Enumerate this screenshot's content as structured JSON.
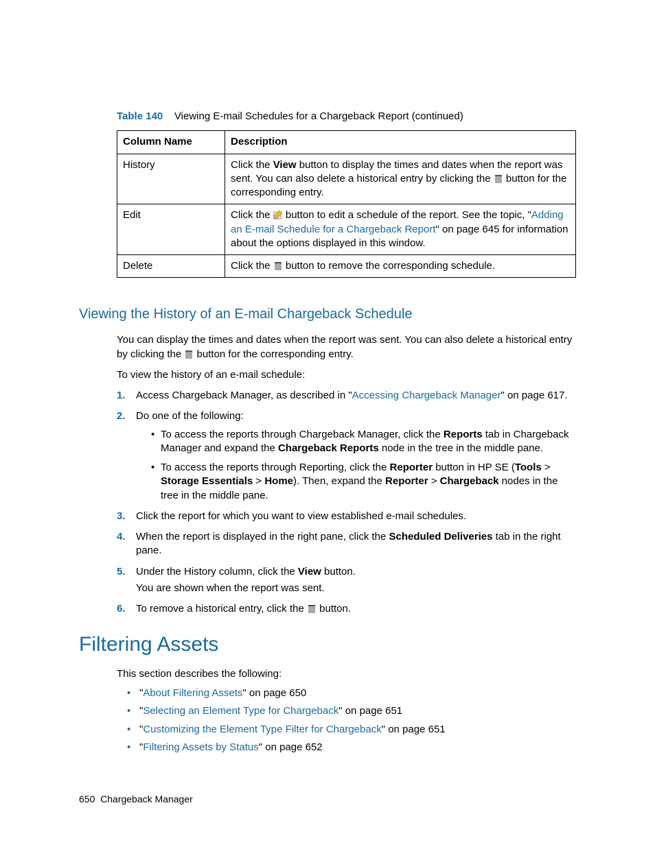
{
  "table": {
    "caption_label": "Table 140",
    "caption_text": "Viewing E-mail Schedules for a Chargeback Report (continued)",
    "head_col1": "Column Name",
    "head_col2": "Description",
    "rows": {
      "history": {
        "name": "History",
        "desc_pre": "Click the ",
        "desc_bold": "View",
        "desc_mid": " button to display the times and dates when the report was sent. You can also delete a historical entry by clicking the ",
        "desc_post": " button for the corresponding entry."
      },
      "edit": {
        "name": "Edit",
        "desc_pre": "Click the ",
        "desc_mid": " button to edit a schedule of the report. See the topic, \"",
        "desc_link": "Adding an E-mail Schedule for a Chargeback Report",
        "desc_post": "\" on page 645 for information about the options displayed in this window."
      },
      "delete": {
        "name": "Delete",
        "desc_pre": "Click the ",
        "desc_post": " button to remove the corresponding schedule."
      }
    }
  },
  "section1": {
    "heading": "Viewing the History of an E-mail Chargeback Schedule",
    "intro_pre": "You can display the times and dates when the report was sent. You can also delete a historical entry by clicking the ",
    "intro_post": " button for the corresponding entry.",
    "intro2": "To view the history of an e-mail schedule:",
    "steps": {
      "s1_pre": "Access Chargeback Manager, as described in \"",
      "s1_link": "Accessing Chargeback Manager",
      "s1_post": "\" on page 617.",
      "s2": "Do one of the following:",
      "s2a_pre": "To access the reports through Chargeback Manager, click the ",
      "s2a_b1": "Reports",
      "s2a_mid": " tab in Chargeback Manager and expand the ",
      "s2a_b2": "Chargeback Reports",
      "s2a_post": " node in the tree in the middle pane.",
      "s2b_pre": "To access the reports through Reporting, click the ",
      "s2b_b1": "Reporter",
      "s2b_mid1": " button in HP SE (",
      "s2b_b2": "Tools",
      "s2b_gt1": " > ",
      "s2b_b3": "Storage Essentials",
      "s2b_gt2": " > ",
      "s2b_b4": "Home",
      "s2b_mid2": "). Then, expand the ",
      "s2b_b5": "Reporter",
      "s2b_gt3": " > ",
      "s2b_b6": "Chargeback",
      "s2b_post": " nodes in the tree in the middle pane.",
      "s3": "Click the report for which you want to view established e-mail schedules.",
      "s4_pre": "When the report is displayed in the right pane, click the ",
      "s4_b": "Scheduled Deliveries",
      "s4_post": " tab in the right pane.",
      "s5_pre": "Under the History column, click the ",
      "s5_b": "View",
      "s5_post": " button.",
      "s5_line2": "You are shown when the report was sent.",
      "s6_pre": "To remove a historical entry, click the ",
      "s6_post": " button."
    }
  },
  "section2": {
    "heading": "Filtering Assets",
    "intro": "This section describes the following:",
    "links": {
      "l1_pre": "\"",
      "l1_link": "About Filtering Assets",
      "l1_post": "\" on page 650",
      "l2_pre": "\"",
      "l2_link": "Selecting an Element Type for Chargeback",
      "l2_post": "\" on page 651",
      "l3_pre": "\"",
      "l3_link": "Customizing the Element Type Filter for Chargeback",
      "l3_post": "\" on page 651",
      "l4_pre": "\"",
      "l4_link": "Filtering Assets by Status",
      "l4_post": "\" on page 652"
    }
  },
  "footer": {
    "page": "650",
    "title": "Chargeback Manager"
  },
  "nums": {
    "n1": "1.",
    "n2": "2.",
    "n3": "3.",
    "n4": "4.",
    "n5": "5.",
    "n6": "6."
  }
}
